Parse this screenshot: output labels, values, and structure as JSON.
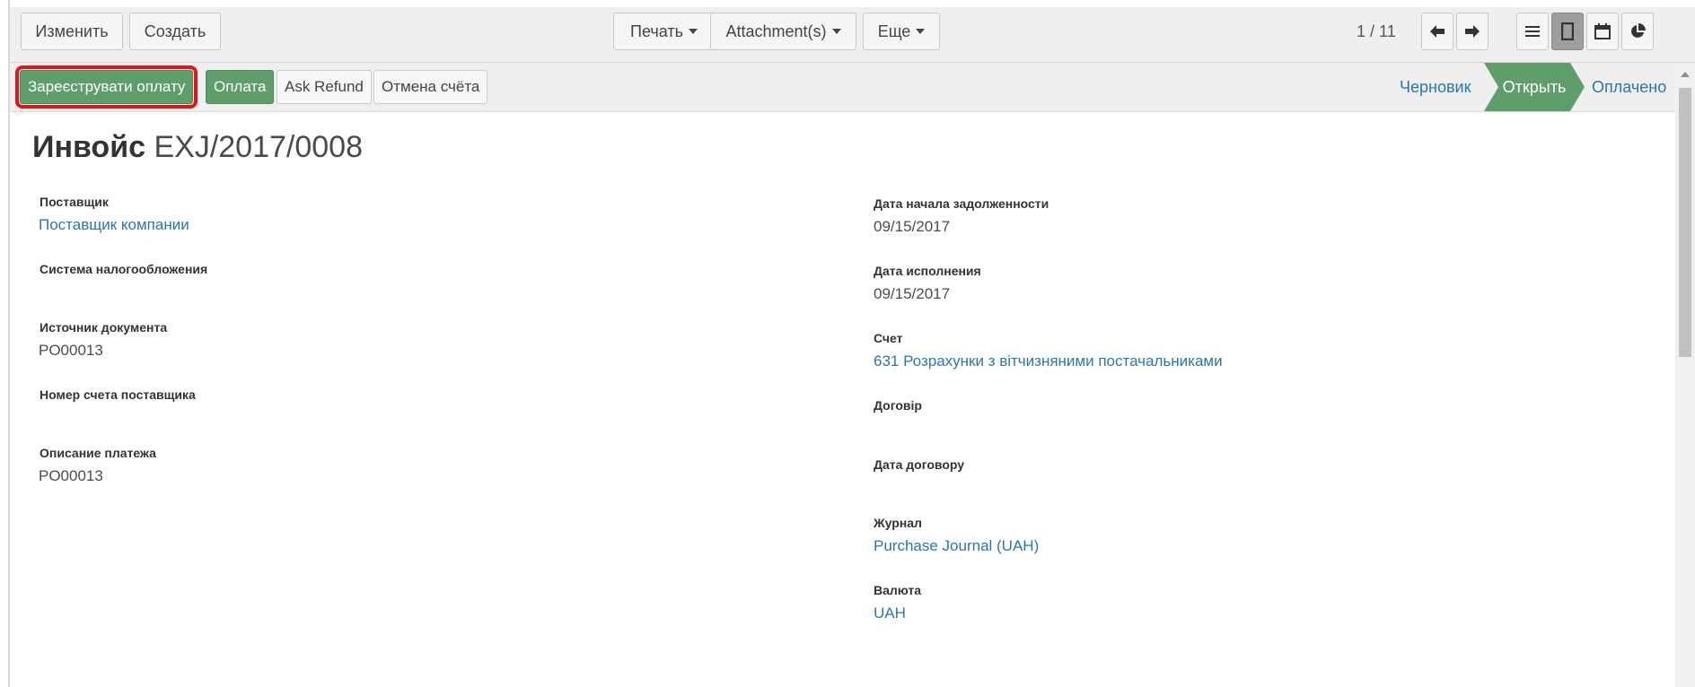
{
  "toolbar": {
    "edit_label": "Изменить",
    "create_label": "Создать",
    "print_label": "Печать",
    "attachments_label": "Attachment(s)",
    "more_label": "Еще",
    "pager": "1 / 11"
  },
  "icons": {
    "prev": "arrow-left-icon",
    "next": "arrow-right-icon",
    "list_view": "list-icon",
    "form_view": "form-icon",
    "calendar_view": "calendar-icon",
    "graph_view": "pie-chart-icon"
  },
  "statusbar": {
    "buttons": [
      "Зареєструвати оплату",
      "Оплата",
      "Ask Refund",
      "Отмена счёта"
    ],
    "stages": [
      "Черновик",
      "Открыть",
      "Оплачено"
    ],
    "active_stage": "Открыть"
  },
  "form": {
    "title_prefix": "Инвойс",
    "title_number": "EXJ/2017/0008",
    "left": [
      {
        "label": "Поставщик",
        "value": "Поставщик компании"
      },
      {
        "label": "Система налогообложения",
        "value": ""
      },
      {
        "label": "Источник документа",
        "value": "PO00013"
      },
      {
        "label": "Номер счета поставщика",
        "value": ""
      },
      {
        "label": "Описание платежа",
        "value": "PO00013"
      }
    ],
    "right": [
      {
        "label": "Дата начала задолженности",
        "value": "09/15/2017"
      },
      {
        "label": "Дата исполнения",
        "value": "09/15/2017"
      },
      {
        "label": "Счет",
        "value": "631 Розрахунки з вітчизняними постачальниками"
      },
      {
        "label": "Договір",
        "value": ""
      },
      {
        "label": "Дата договору",
        "value": ""
      },
      {
        "label": "Журнал",
        "value": "Purchase Journal (UAH)"
      },
      {
        "label": "Валюта",
        "value": "UAH"
      }
    ]
  },
  "colors": {
    "primary_button": "#5f9e6a",
    "link": "#2a77ad",
    "highlight_box": "#e2141a"
  }
}
